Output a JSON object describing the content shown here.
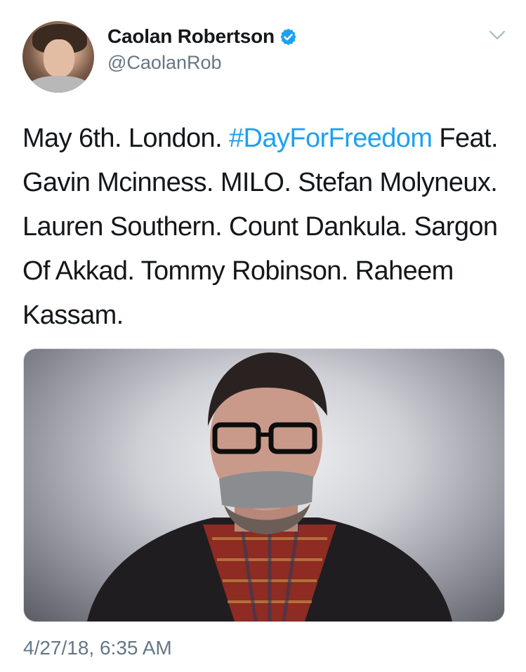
{
  "tweet": {
    "author": {
      "display_name": "Caolan Robertson",
      "handle": "@CaolanRob",
      "verified": true
    },
    "text": {
      "before_hashtag": "May 6th. London. ",
      "hashtag": "#DayForFreedom",
      "after_hashtag": " Feat. Gavin Mcinness. MILO. Stefan Molyneux. Lauren Southern. Count Dankula. Sargon Of Akkad. Tommy Robinson. Raheem Kassam."
    },
    "timestamp": "4/27/18, 6:35 AM"
  },
  "icons": {
    "verified": "verified-badge-icon",
    "menu": "chevron-down-icon"
  },
  "colors": {
    "link": "#1da1f2",
    "verified": "#1da1f2",
    "secondary_text": "#657786",
    "primary_text": "#14171a"
  }
}
